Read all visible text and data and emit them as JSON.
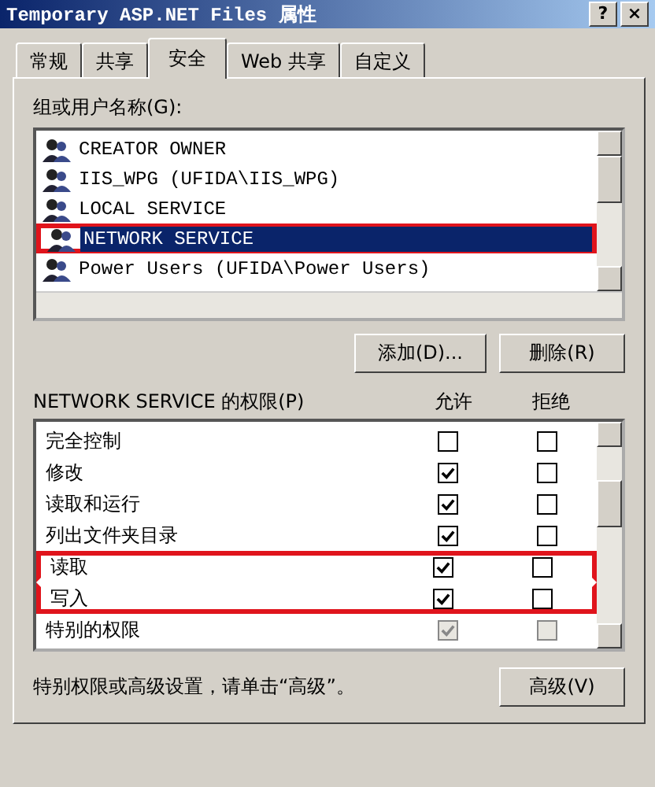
{
  "window": {
    "title": "Temporary ASP.NET Files 属性",
    "buttons": [
      "?",
      "×"
    ]
  },
  "tabs": [
    {
      "label": "常规",
      "selected": false
    },
    {
      "label": "共享",
      "selected": false
    },
    {
      "label": "安全",
      "selected": true
    },
    {
      "label": "Web 共享",
      "selected": false
    },
    {
      "label": "自定义",
      "selected": false
    }
  ],
  "users_label": "组或用户名称(G):",
  "users": [
    {
      "name": "CREATOR OWNER",
      "selected": false,
      "highlighted": false
    },
    {
      "name": "IIS_WPG (UFIDA\\IIS_WPG)",
      "selected": false,
      "highlighted": false
    },
    {
      "name": "LOCAL SERVICE",
      "selected": false,
      "highlighted": false
    },
    {
      "name": "NETWORK SERVICE",
      "selected": true,
      "highlighted": true
    },
    {
      "name": "Power Users (UFIDA\\Power Users)",
      "selected": false,
      "highlighted": false
    }
  ],
  "user_buttons": [
    "添加(D)...",
    "删除(R)"
  ],
  "permissions_label": "NETWORK SERVICE 的权限(P)",
  "columns": [
    "允许",
    "拒绝"
  ],
  "permissions": [
    {
      "name": "完全控制",
      "allow": false,
      "deny": false,
      "disabled": false,
      "highlighted": false
    },
    {
      "name": "修改",
      "allow": true,
      "deny": false,
      "disabled": false,
      "highlighted": false
    },
    {
      "name": "读取和运行",
      "allow": true,
      "deny": false,
      "disabled": false,
      "highlighted": false
    },
    {
      "name": "列出文件夹目录",
      "allow": true,
      "deny": false,
      "disabled": false,
      "highlighted": false
    },
    {
      "name": "读取",
      "allow": true,
      "deny": false,
      "disabled": false,
      "highlighted": true
    },
    {
      "name": "写入",
      "allow": true,
      "deny": false,
      "disabled": false,
      "highlighted": true
    },
    {
      "name": "特别的权限",
      "allow": true,
      "deny": false,
      "disabled": true,
      "highlighted": false
    }
  ],
  "advanced_note": "特别权限或高级设置，请单击“高级”。",
  "advanced_button": "高级(V)"
}
